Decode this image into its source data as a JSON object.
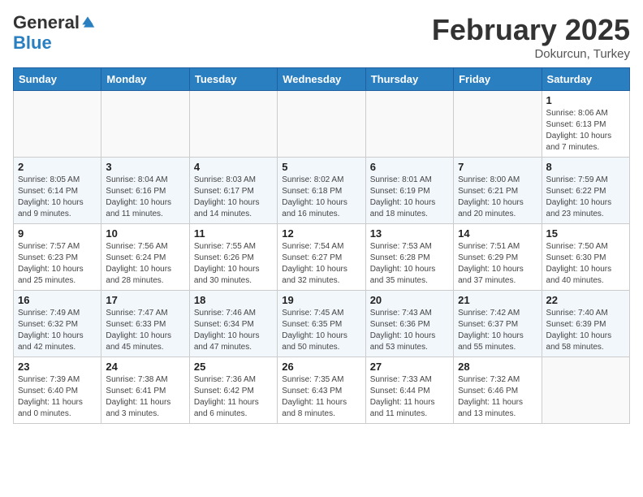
{
  "header": {
    "logo_general": "General",
    "logo_blue": "Blue",
    "month_title": "February 2025",
    "location": "Dokurcun, Turkey"
  },
  "columns": [
    "Sunday",
    "Monday",
    "Tuesday",
    "Wednesday",
    "Thursday",
    "Friday",
    "Saturday"
  ],
  "weeks": [
    [
      {
        "day": "",
        "info": ""
      },
      {
        "day": "",
        "info": ""
      },
      {
        "day": "",
        "info": ""
      },
      {
        "day": "",
        "info": ""
      },
      {
        "day": "",
        "info": ""
      },
      {
        "day": "",
        "info": ""
      },
      {
        "day": "1",
        "info": "Sunrise: 8:06 AM\nSunset: 6:13 PM\nDaylight: 10 hours and 7 minutes."
      }
    ],
    [
      {
        "day": "2",
        "info": "Sunrise: 8:05 AM\nSunset: 6:14 PM\nDaylight: 10 hours and 9 minutes."
      },
      {
        "day": "3",
        "info": "Sunrise: 8:04 AM\nSunset: 6:16 PM\nDaylight: 10 hours and 11 minutes."
      },
      {
        "day": "4",
        "info": "Sunrise: 8:03 AM\nSunset: 6:17 PM\nDaylight: 10 hours and 14 minutes."
      },
      {
        "day": "5",
        "info": "Sunrise: 8:02 AM\nSunset: 6:18 PM\nDaylight: 10 hours and 16 minutes."
      },
      {
        "day": "6",
        "info": "Sunrise: 8:01 AM\nSunset: 6:19 PM\nDaylight: 10 hours and 18 minutes."
      },
      {
        "day": "7",
        "info": "Sunrise: 8:00 AM\nSunset: 6:21 PM\nDaylight: 10 hours and 20 minutes."
      },
      {
        "day": "8",
        "info": "Sunrise: 7:59 AM\nSunset: 6:22 PM\nDaylight: 10 hours and 23 minutes."
      }
    ],
    [
      {
        "day": "9",
        "info": "Sunrise: 7:57 AM\nSunset: 6:23 PM\nDaylight: 10 hours and 25 minutes."
      },
      {
        "day": "10",
        "info": "Sunrise: 7:56 AM\nSunset: 6:24 PM\nDaylight: 10 hours and 28 minutes."
      },
      {
        "day": "11",
        "info": "Sunrise: 7:55 AM\nSunset: 6:26 PM\nDaylight: 10 hours and 30 minutes."
      },
      {
        "day": "12",
        "info": "Sunrise: 7:54 AM\nSunset: 6:27 PM\nDaylight: 10 hours and 32 minutes."
      },
      {
        "day": "13",
        "info": "Sunrise: 7:53 AM\nSunset: 6:28 PM\nDaylight: 10 hours and 35 minutes."
      },
      {
        "day": "14",
        "info": "Sunrise: 7:51 AM\nSunset: 6:29 PM\nDaylight: 10 hours and 37 minutes."
      },
      {
        "day": "15",
        "info": "Sunrise: 7:50 AM\nSunset: 6:30 PM\nDaylight: 10 hours and 40 minutes."
      }
    ],
    [
      {
        "day": "16",
        "info": "Sunrise: 7:49 AM\nSunset: 6:32 PM\nDaylight: 10 hours and 42 minutes."
      },
      {
        "day": "17",
        "info": "Sunrise: 7:47 AM\nSunset: 6:33 PM\nDaylight: 10 hours and 45 minutes."
      },
      {
        "day": "18",
        "info": "Sunrise: 7:46 AM\nSunset: 6:34 PM\nDaylight: 10 hours and 47 minutes."
      },
      {
        "day": "19",
        "info": "Sunrise: 7:45 AM\nSunset: 6:35 PM\nDaylight: 10 hours and 50 minutes."
      },
      {
        "day": "20",
        "info": "Sunrise: 7:43 AM\nSunset: 6:36 PM\nDaylight: 10 hours and 53 minutes."
      },
      {
        "day": "21",
        "info": "Sunrise: 7:42 AM\nSunset: 6:37 PM\nDaylight: 10 hours and 55 minutes."
      },
      {
        "day": "22",
        "info": "Sunrise: 7:40 AM\nSunset: 6:39 PM\nDaylight: 10 hours and 58 minutes."
      }
    ],
    [
      {
        "day": "23",
        "info": "Sunrise: 7:39 AM\nSunset: 6:40 PM\nDaylight: 11 hours and 0 minutes."
      },
      {
        "day": "24",
        "info": "Sunrise: 7:38 AM\nSunset: 6:41 PM\nDaylight: 11 hours and 3 minutes."
      },
      {
        "day": "25",
        "info": "Sunrise: 7:36 AM\nSunset: 6:42 PM\nDaylight: 11 hours and 6 minutes."
      },
      {
        "day": "26",
        "info": "Sunrise: 7:35 AM\nSunset: 6:43 PM\nDaylight: 11 hours and 8 minutes."
      },
      {
        "day": "27",
        "info": "Sunrise: 7:33 AM\nSunset: 6:44 PM\nDaylight: 11 hours and 11 minutes."
      },
      {
        "day": "28",
        "info": "Sunrise: 7:32 AM\nSunset: 6:46 PM\nDaylight: 11 hours and 13 minutes."
      },
      {
        "day": "",
        "info": ""
      }
    ]
  ]
}
